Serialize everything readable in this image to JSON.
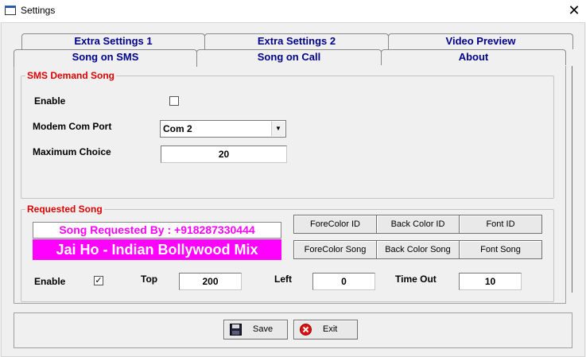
{
  "window": {
    "title": "Settings",
    "close_glyph": "✕"
  },
  "tabs_row1": [
    {
      "label": "Extra Settings 1"
    },
    {
      "label": "Extra Settings 2"
    },
    {
      "label": "Video Preview"
    }
  ],
  "tabs_row2": [
    {
      "label": "Song on SMS",
      "active": true
    },
    {
      "label": "Song on Call"
    },
    {
      "label": "About"
    }
  ],
  "sms_group": {
    "title": "SMS Demand Song",
    "enable_label": "Enable",
    "enable_checked": false,
    "port_label": "Modem Com Port",
    "port_value": "Com 2",
    "max_label": "Maximum Choice",
    "max_value": "20"
  },
  "requested_group": {
    "title": "Requested Song",
    "preview_line1": "Song Requested By : +918287330444",
    "preview_line2": "Jai Ho - Indian Bollywood Mix",
    "buttons": [
      "ForeColor ID",
      "Back Color ID",
      "Font ID",
      "ForeColor Song",
      "Back Color Song",
      "Font Song"
    ],
    "enable_label": "Enable",
    "enable_checked": true,
    "check_glyph": "✓",
    "top_label": "Top",
    "top_value": "200",
    "left_label": "Left",
    "left_value": "0",
    "timeout_label": "Time Out",
    "timeout_value": "10"
  },
  "footer": {
    "save_label": "Save",
    "exit_label": "Exit",
    "save_icon": "floppy-disk-icon",
    "exit_icon": "close-circle-icon"
  },
  "colors": {
    "accent_red": "#e00000",
    "tab_text": "#00008b",
    "preview_magenta": "#ff00ff"
  }
}
